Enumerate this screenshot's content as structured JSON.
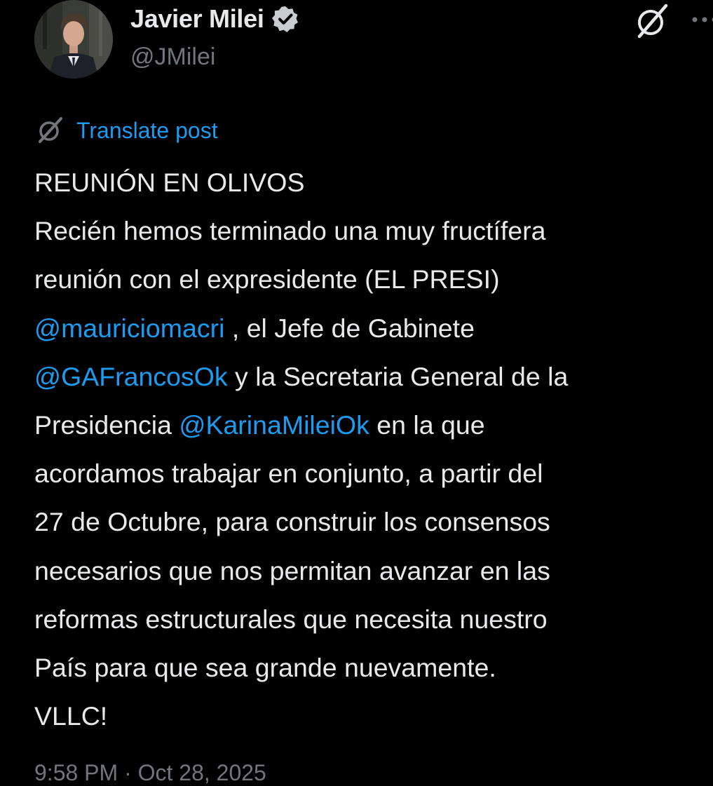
{
  "author": {
    "display_name": "Javier Milei",
    "handle": "@JMilei",
    "verified": true
  },
  "icons": {
    "verified": "verified-badge-icon",
    "grok": "grok-icon",
    "more": "more-icon",
    "translate": "grok-translate-icon"
  },
  "colors": {
    "background": "#000000",
    "text": "#e7e9ea",
    "muted": "#71767b",
    "link": "#1d9bf0"
  },
  "post": {
    "translate_label": "Translate post",
    "lines": {
      "l1": "REUNIÓN EN OLIVOS",
      "l2": "Recién hemos terminado una muy fructífera",
      "l3": "reunión con el expresidente (EL PRESI)",
      "l4_mention": "@mauriciomacri",
      "l4_text": " , el Jefe de Gabinete",
      "l5_mention": "@GAFrancosOk",
      "l5_text": " y la Secretaria General de la",
      "l6_text": "Presidencia ",
      "l6_mention": "@KarinaMileiOk",
      "l6_text2": " en la que",
      "l7": "acordamos trabajar en conjunto, a partir del",
      "l8": "27 de Octubre, para construir los consensos",
      "l9": "necesarios que nos permitan avanzar en las",
      "l10": "reformas estructurales que necesita nuestro",
      "l11": "País para que sea grande nuevamente.",
      "l12": "VLLC!"
    },
    "timestamp": "9:58 PM · Oct 28, 2025"
  }
}
